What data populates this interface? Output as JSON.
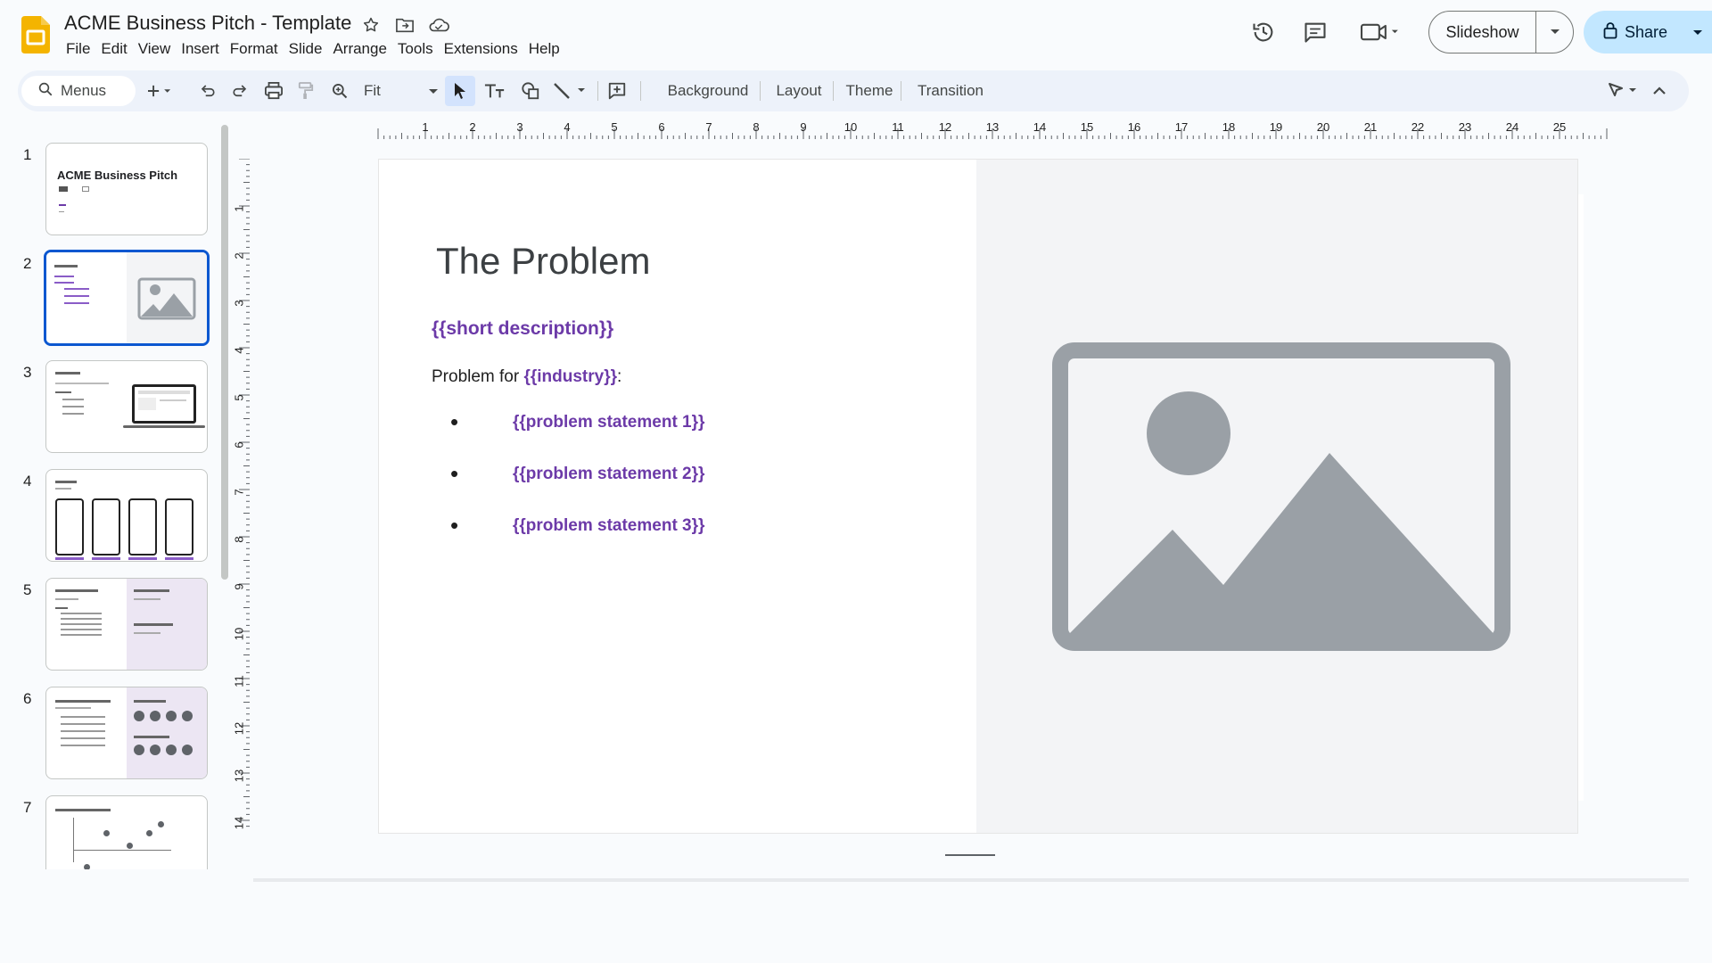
{
  "app": {
    "doc_title": "ACME Business Pitch - Template"
  },
  "menu": [
    "File",
    "Edit",
    "View",
    "Insert",
    "Format",
    "Slide",
    "Arrange",
    "Tools",
    "Extensions",
    "Help"
  ],
  "header": {
    "slideshow_label": "Slideshow",
    "share_label": "Share"
  },
  "toolbar": {
    "search_label": "Menus",
    "zoom_label": "Fit",
    "background_label": "Background",
    "layout_label": "Layout",
    "theme_label": "Theme",
    "transition_label": "Transition"
  },
  "filmstrip": {
    "numbers": [
      "1",
      "2",
      "3",
      "4",
      "5",
      "6",
      "7"
    ],
    "selected": 2,
    "thumb1_title": "ACME Business Pitch"
  },
  "ruler": {
    "horizontal": [
      "1",
      "2",
      "3",
      "4",
      "5",
      "6",
      "7",
      "8",
      "9",
      "10",
      "11",
      "12",
      "13",
      "14",
      "15",
      "16",
      "17",
      "18",
      "19",
      "20",
      "21",
      "22",
      "23",
      "24",
      "25"
    ],
    "vertical": [
      "1",
      "2",
      "3",
      "4",
      "5",
      "6",
      "7",
      "8",
      "9",
      "10",
      "11",
      "12",
      "13",
      "14"
    ]
  },
  "slide": {
    "title": "The Problem",
    "short_description": "{{short description}}",
    "problem_prefix": "Problem for ",
    "industry": "{{industry}}",
    "problem_suffix": ":",
    "bullets": [
      "{{problem statement 1}}",
      "{{problem statement 2}}",
      "{{problem statement 3}}"
    ]
  },
  "colors": {
    "accent_blue": "#0b57d0",
    "placeholder_purple": "#6c3aa8",
    "share_bg": "#c2e7ff",
    "slides_yellow": "#f4b400"
  }
}
